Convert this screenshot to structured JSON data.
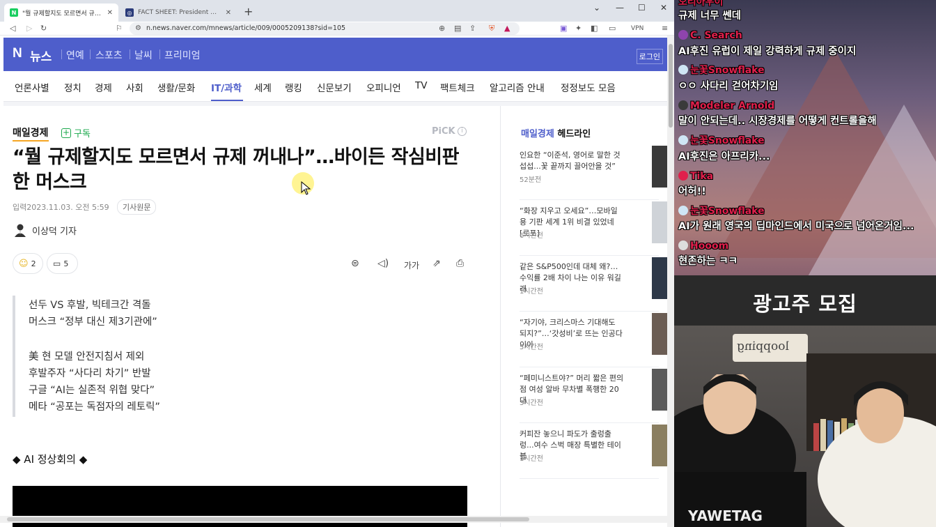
{
  "browser": {
    "tabs": [
      {
        "title": "\"뭘 규제할지도 모르면서 규제 꺼내나\"…",
        "favicon": "N"
      },
      {
        "title": "FACT SHEET: President Biden Issues E",
        "favicon": "◎"
      }
    ],
    "new_tab": "+",
    "window_controls": [
      "⌄",
      "—",
      "☐",
      "✕"
    ],
    "url": "n.news.naver.com/mnews/article/009/0005209138?sid=105",
    "vpn_label": "VPN"
  },
  "naver": {
    "logo": "N",
    "section_name": "뉴스",
    "top_nav": [
      "연예",
      "스포츠",
      "날씨",
      "프리미엄"
    ],
    "login": "로그인",
    "categories": [
      "언론사별",
      "정치",
      "경제",
      "사회",
      "생활/문화",
      "IT/과학",
      "세계",
      "랭킹",
      "신문보기",
      "오피니언",
      "TV",
      "팩트체크",
      "알고리즘 안내",
      "정정보도 모음"
    ],
    "active_category": "IT/과학"
  },
  "article": {
    "press": "매일경제",
    "subscribe": "구독",
    "pick": "PiCK",
    "headline": "“뭘 규제할지도 모르면서 규제 꺼내나”…바이든 작심비판한 머스크",
    "date": "입력2023.11.03. 오전 5:59",
    "original_link": "기사원문",
    "reporter": "이상덕 기자",
    "reaction_count": "2",
    "comment_count": "5",
    "font_size_tool": "가가",
    "summary": [
      "선두 VS 후발, 빅테크간 격돌",
      "머스크 “정부 대신 제3기관에”",
      "",
      "美 현 모델 안전지침서 제외",
      "후발주자 “사다리 차기” 반발",
      "구글 “AI는 실존적 위협 맞다”",
      "메타 “공포는 독점자의 레토릭”"
    ],
    "section_heading": "◆ AI 정상회의 ◆"
  },
  "headlines": {
    "press": "매일경제",
    "title": "헤드라인",
    "items": [
      {
        "title": "인요한 “이준석, 영어로 말한 것 섭섭...꽃 끝까지 끌어안을 것”",
        "time": "52분전"
      },
      {
        "title": "“화장 지우고 오세요”…모바일용 기판 세계 1위 비결 있었네 [르포]",
        "time": "6시간전"
      },
      {
        "title": "같은 S&P500인데 대체 왜?…수익률 2배 차이 나는 이유 워길래",
        "time": "1시간전"
      },
      {
        "title": "“자기야, 크리스마스 기대해도 되지?”…‘갓성비’로 뜨는 인공다이아",
        "time": "5시간전"
      },
      {
        "title": "“페미니스트야?” 머리 짧은 편의점 여성 알바 무차별 폭행한 20대",
        "time": "3시간전"
      },
      {
        "title": "커피잔 놓으니 파도가 출렁출렁...여수 스벅 매장 특별한 테이블",
        "time": "1시간전"
      }
    ]
  },
  "chat": {
    "messages": [
      {
        "user": "오리아우이",
        "text": "규제 너무 쎈데"
      },
      {
        "user": "C. Search",
        "text": "AI후진 유럽이 제일 강력하게 규제 중이지"
      },
      {
        "user": "눈꽃Snowflake",
        "text": "ㅇㅇ 사다리 걷어차기임"
      },
      {
        "user": "Modeler Arnold",
        "text": "말이 안되는데.. 시장경제를 어떻게 컨트롤을해"
      },
      {
        "user": "눈꽃Snowflake",
        "text": "AI후진은 아프리카..."
      },
      {
        "user": "Tika",
        "text": "어허!!"
      },
      {
        "user": "눈꽃Snowflake",
        "text": "AI가 원래 영국의 딥마인드에서 미국으로 넘어온거임..."
      },
      {
        "user": "Hooom",
        "text": "현존하는 ㅋㅋ"
      }
    ]
  },
  "ad_banner": {
    "text": "광고주 모집"
  },
  "webcam": {
    "sign": "loopping"
  },
  "colors": {
    "naver_blue": "#4e5ecb",
    "subscribe_green": "#1aa84b",
    "chat_user_red": "#e0204c"
  }
}
